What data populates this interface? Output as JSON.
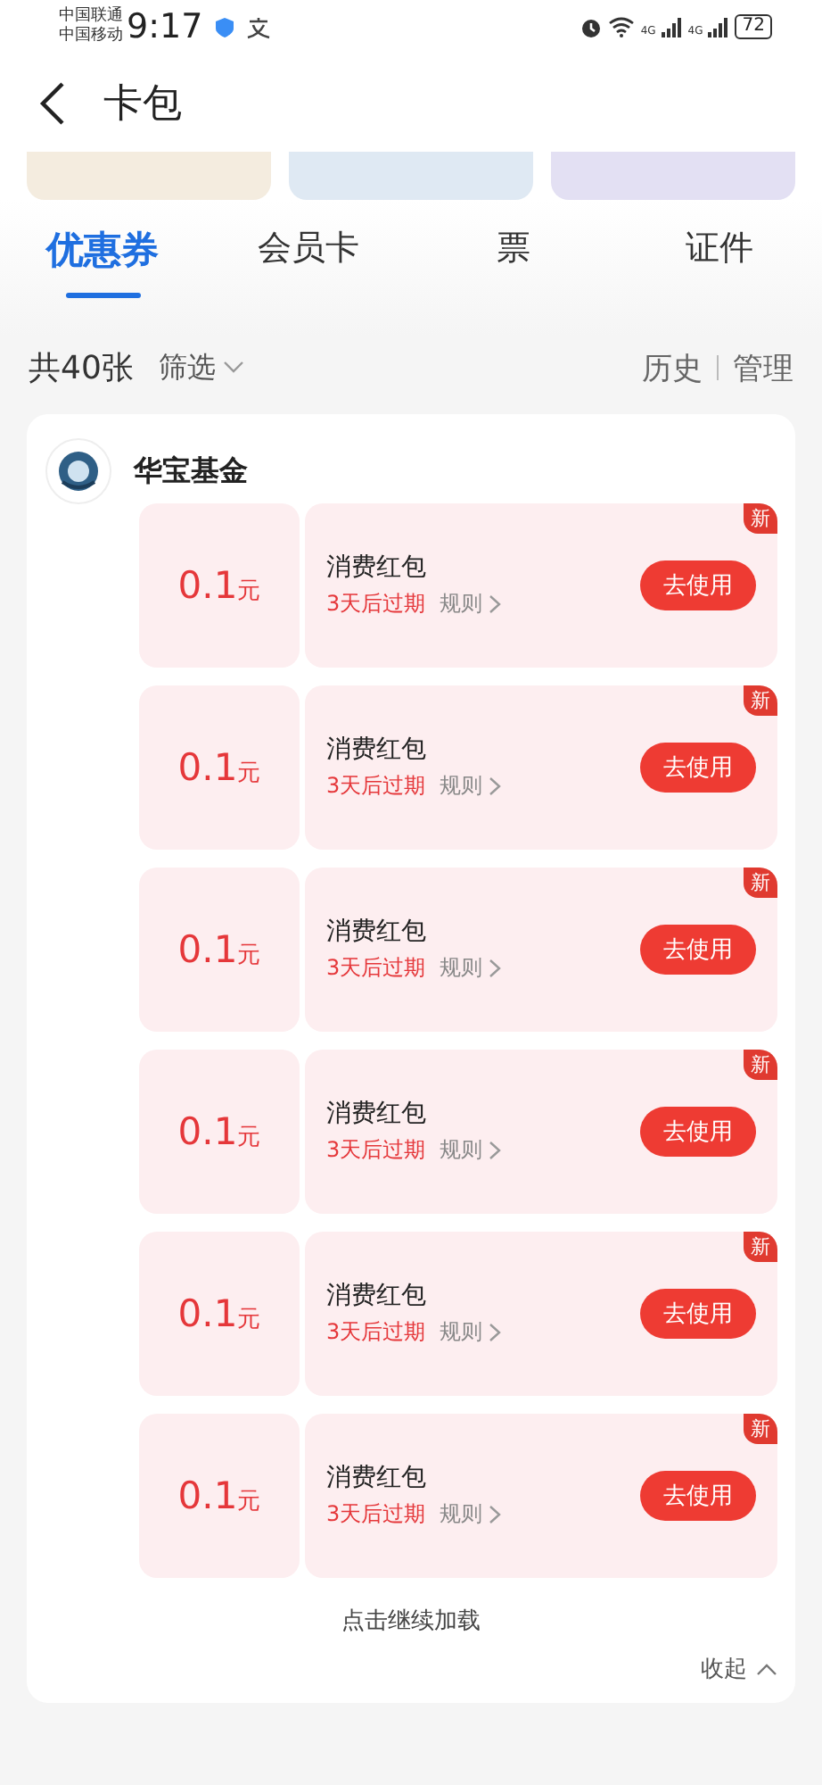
{
  "status_bar": {
    "carriers": [
      "中国联通",
      "中国移动"
    ],
    "time": "9:17",
    "network": [
      "4G",
      "4G"
    ],
    "battery": "72"
  },
  "header": {
    "title": "卡包"
  },
  "banners": [
    {
      "color": "#f4ecdf"
    },
    {
      "color": "#dfe9f3"
    },
    {
      "color": "#e3e0f3"
    }
  ],
  "tabs": [
    {
      "label": "优惠券",
      "selected": true
    },
    {
      "label": "会员卡",
      "selected": false
    },
    {
      "label": "票",
      "selected": false
    },
    {
      "label": "证件",
      "selected": false
    }
  ],
  "summary": {
    "count": "共40张",
    "filter": "筛选",
    "history": "历史",
    "manage": "管理"
  },
  "group": {
    "name": "华宝基金",
    "coupons": [
      {
        "amount": "0.1",
        "unit": "元",
        "title": "消费红包",
        "expiry": "3天后过期",
        "rules": "规则",
        "button": "去使用",
        "badge": "新"
      },
      {
        "amount": "0.1",
        "unit": "元",
        "title": "消费红包",
        "expiry": "3天后过期",
        "rules": "规则",
        "button": "去使用",
        "badge": "新"
      },
      {
        "amount": "0.1",
        "unit": "元",
        "title": "消费红包",
        "expiry": "3天后过期",
        "rules": "规则",
        "button": "去使用",
        "badge": "新"
      },
      {
        "amount": "0.1",
        "unit": "元",
        "title": "消费红包",
        "expiry": "3天后过期",
        "rules": "规则",
        "button": "去使用",
        "badge": "新"
      },
      {
        "amount": "0.1",
        "unit": "元",
        "title": "消费红包",
        "expiry": "3天后过期",
        "rules": "规则",
        "button": "去使用",
        "badge": "新"
      },
      {
        "amount": "0.1",
        "unit": "元",
        "title": "消费红包",
        "expiry": "3天后过期",
        "rules": "规则",
        "button": "去使用",
        "badge": "新"
      }
    ],
    "load_more": "点击继续加载",
    "collapse": "收起"
  }
}
